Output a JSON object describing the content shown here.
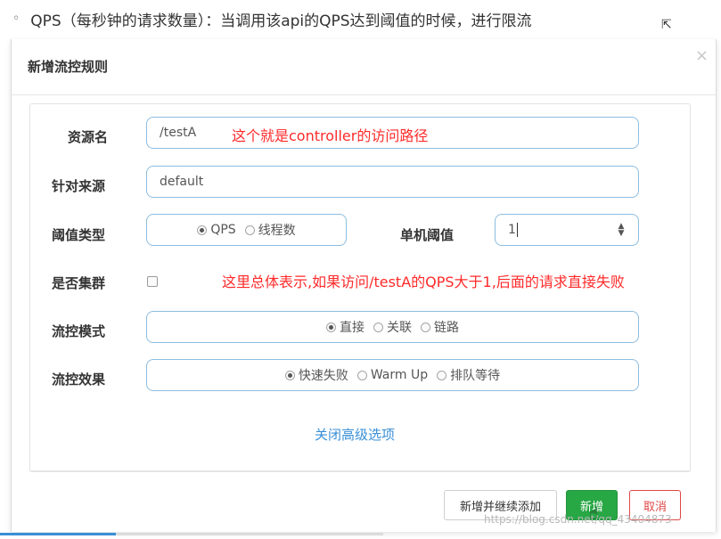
{
  "doc": {
    "bullet": "◦",
    "text": "QPS（每秒钟的请求数量）：当调用该api的QPS达到阈值的时候，进行限流"
  },
  "dialog": {
    "title": "新增流控规则",
    "close_glyph": "×",
    "resource": {
      "label": "资源名",
      "value": "/testA",
      "annotation": "这个就是controller的访问路径"
    },
    "origin": {
      "label": "针对来源",
      "value": "default"
    },
    "threshold_type": {
      "label": "阈值类型",
      "options": [
        "QPS",
        "线程数"
      ],
      "selected": "QPS"
    },
    "single_threshold": {
      "label": "单机阈值",
      "value": "1"
    },
    "cluster": {
      "label": "是否集群",
      "checked": false,
      "annotation": "这里总体表示,如果访问/testA的QPS大于1,后面的请求直接失败"
    },
    "mode": {
      "label": "流控模式",
      "options": [
        "直接",
        "关联",
        "链路"
      ],
      "selected": "直接"
    },
    "effect": {
      "label": "流控效果",
      "options": [
        "快速失败",
        "Warm Up",
        "排队等待"
      ],
      "selected": "快速失败"
    },
    "advanced_link": "关闭高级选项",
    "buttons": {
      "add_continue": "新增并继续添加",
      "add": "新增",
      "cancel": "取消"
    }
  },
  "watermark": "https://blog.csdn.net/qq_43404873",
  "colors": {
    "annotation_red": "#ff2a2a",
    "input_border": "#8cbde0",
    "link_blue": "#3a8fd6",
    "primary_green": "#28a745",
    "danger_red": "#e04848"
  }
}
